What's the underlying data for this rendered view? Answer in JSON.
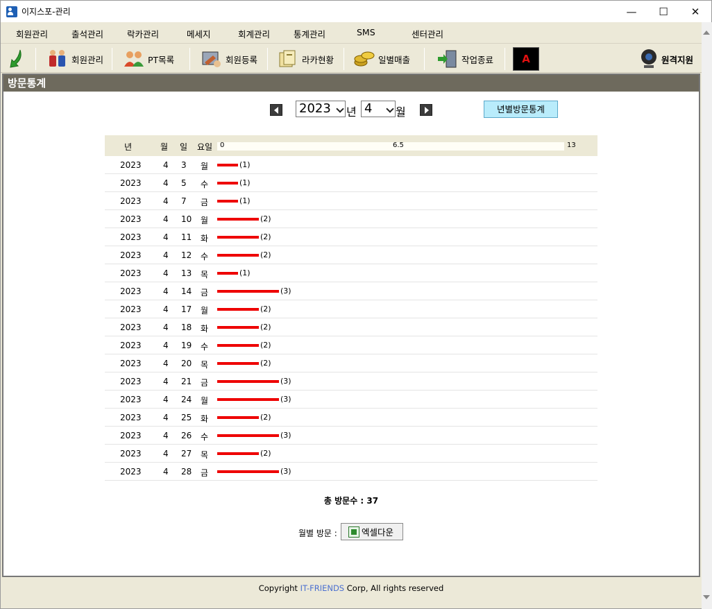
{
  "window": {
    "title": "이지스포-관리",
    "minimize": "—",
    "maximize": "☐",
    "close": "✕"
  },
  "menu": [
    "회원관리",
    "출석관리",
    "락카관리",
    "메세지",
    "회계관리",
    "통계관리",
    "SMS",
    "센터관리"
  ],
  "toolbar": {
    "back_icon": "green-arrow-icon",
    "items": [
      "회원관리",
      "PT목록",
      "회원등록",
      "라카현황",
      "일별매출",
      "작업종료"
    ],
    "adobe_icon": "adobe-icon",
    "remote": "원격지원"
  },
  "panel": {
    "title": "방문통계"
  },
  "filter": {
    "year": "2023",
    "year_suffix": "년",
    "month": "4",
    "month_suffix": "월",
    "yearly_button": "년별방문통계"
  },
  "table": {
    "headers": [
      "년",
      "월",
      "일",
      "요일"
    ],
    "scale": [
      "0",
      "6.5",
      "13"
    ],
    "rows": [
      {
        "year": "2023",
        "month": "4",
        "day": "3",
        "weekday": "월",
        "count": 1,
        "label": "(1)"
      },
      {
        "year": "2023",
        "month": "4",
        "day": "5",
        "weekday": "수",
        "count": 1,
        "label": "(1)"
      },
      {
        "year": "2023",
        "month": "4",
        "day": "7",
        "weekday": "금",
        "count": 1,
        "label": "(1)"
      },
      {
        "year": "2023",
        "month": "4",
        "day": "10",
        "weekday": "월",
        "count": 2,
        "label": "(2)"
      },
      {
        "year": "2023",
        "month": "4",
        "day": "11",
        "weekday": "화",
        "count": 2,
        "label": "(2)"
      },
      {
        "year": "2023",
        "month": "4",
        "day": "12",
        "weekday": "수",
        "count": 2,
        "label": "(2)"
      },
      {
        "year": "2023",
        "month": "4",
        "day": "13",
        "weekday": "목",
        "count": 1,
        "label": "(1)"
      },
      {
        "year": "2023",
        "month": "4",
        "day": "14",
        "weekday": "금",
        "count": 3,
        "label": "(3)"
      },
      {
        "year": "2023",
        "month": "4",
        "day": "17",
        "weekday": "월",
        "count": 2,
        "label": "(2)"
      },
      {
        "year": "2023",
        "month": "4",
        "day": "18",
        "weekday": "화",
        "count": 2,
        "label": "(2)"
      },
      {
        "year": "2023",
        "month": "4",
        "day": "19",
        "weekday": "수",
        "count": 2,
        "label": "(2)"
      },
      {
        "year": "2023",
        "month": "4",
        "day": "20",
        "weekday": "목",
        "count": 2,
        "label": "(2)"
      },
      {
        "year": "2023",
        "month": "4",
        "day": "21",
        "weekday": "금",
        "count": 3,
        "label": "(3)"
      },
      {
        "year": "2023",
        "month": "4",
        "day": "24",
        "weekday": "월",
        "count": 3,
        "label": "(3)"
      },
      {
        "year": "2023",
        "month": "4",
        "day": "25",
        "weekday": "화",
        "count": 2,
        "label": "(2)"
      },
      {
        "year": "2023",
        "month": "4",
        "day": "26",
        "weekday": "수",
        "count": 3,
        "label": "(3)"
      },
      {
        "year": "2023",
        "month": "4",
        "day": "27",
        "weekday": "목",
        "count": 2,
        "label": "(2)"
      },
      {
        "year": "2023",
        "month": "4",
        "day": "28",
        "weekday": "금",
        "count": 3,
        "label": "(3)"
      }
    ]
  },
  "chart_data": {
    "type": "bar",
    "categories": [
      "3",
      "5",
      "7",
      "10",
      "11",
      "12",
      "13",
      "14",
      "17",
      "18",
      "19",
      "20",
      "21",
      "24",
      "25",
      "26",
      "27",
      "28"
    ],
    "values": [
      1,
      1,
      1,
      2,
      2,
      2,
      1,
      3,
      2,
      2,
      2,
      2,
      3,
      3,
      2,
      3,
      2,
      3
    ],
    "xlim": [
      0,
      13
    ],
    "ticks": [
      "0",
      "6.5",
      "13"
    ],
    "orientation": "horizontal",
    "color": "#ee0000"
  },
  "total": "총 방문수 : 37",
  "monthly": {
    "label": "월별 방문 :",
    "excel_button": "엑셀다운"
  },
  "footer": {
    "prefix": "Copyright ",
    "brand": "IT-FRIENDS",
    "suffix": " Corp, All rights reserved"
  }
}
